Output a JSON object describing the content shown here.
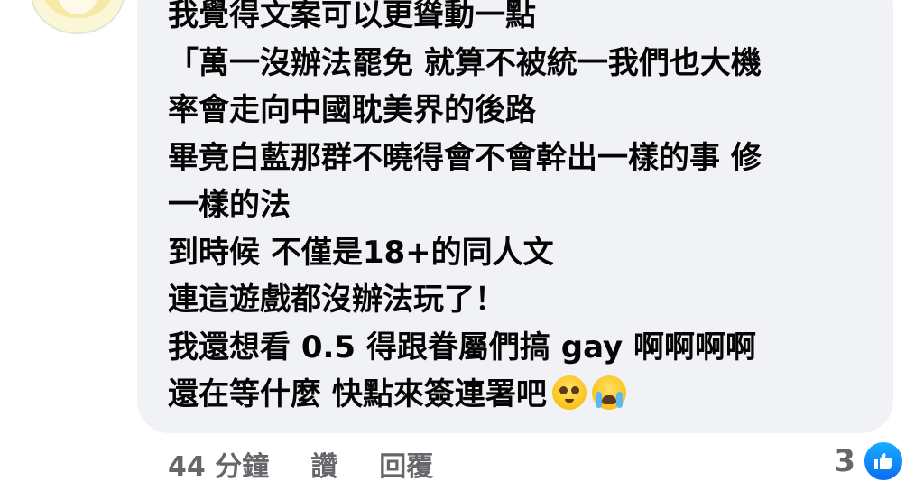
{
  "comment": {
    "lines": [
      "我覺得文案可以更聳動一點",
      "「萬一沒辦法罷免 就算不被統一我們也大機",
      "率會走向中國耽美界的後路",
      "畢竟白藍那群不曉得會不會幹出一樣的事 修",
      "一樣的法",
      "到時候 不僅是18+的同人文",
      "連這遊戲都沒辦法玩了！",
      "我還想看 0.5 得跟眷屬們搞 gay 啊啊啊啊",
      "還在等什麼 快點來簽連署吧"
    ],
    "emojis": [
      "pleading-face-icon",
      "loudly-crying-face-icon"
    ]
  },
  "actions": {
    "time": "44 分鐘",
    "like_label": "讚",
    "reply_label": "回覆"
  },
  "reactions": {
    "count": "3",
    "icon": "thumbs-up-icon",
    "badge_color": "#1877f2"
  },
  "colors": {
    "bubble": "#f0f2f5",
    "text": "#050505",
    "meta": "#65676b"
  }
}
